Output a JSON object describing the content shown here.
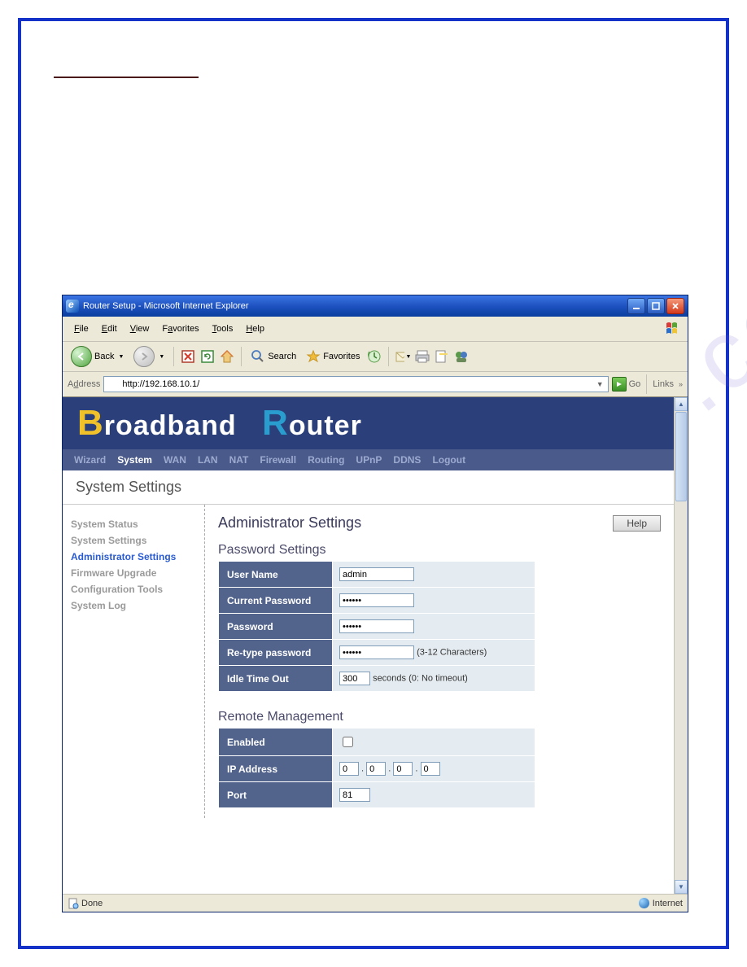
{
  "window": {
    "title": "Router Setup - Microsoft Internet Explorer"
  },
  "menubar": [
    "File",
    "Edit",
    "View",
    "Favorites",
    "Tools",
    "Help"
  ],
  "toolbar": {
    "back": "Back",
    "search": "Search",
    "favorites": "Favorites"
  },
  "addressbar": {
    "label": "Address",
    "url": "http://192.168.10.1/",
    "go": "Go",
    "links": "Links"
  },
  "router": {
    "brand_word1": "roadband",
    "brand_word2": "outer",
    "nav": [
      "Wizard",
      "System",
      "WAN",
      "LAN",
      "NAT",
      "Firewall",
      "Routing",
      "UPnP",
      "DDNS",
      "Logout"
    ],
    "active_nav": "System",
    "page_title": "System Settings",
    "sidebar": [
      "System Status",
      "System Settings",
      "Administrator Settings",
      "Firmware Upgrade",
      "Configuration Tools",
      "System Log"
    ],
    "active_sidebar": "Administrator Settings",
    "heading": "Administrator Settings",
    "help": "Help",
    "section1": {
      "title": "Password Settings",
      "username_label": "User Name",
      "username_value": "admin",
      "current_pw_label": "Current Password",
      "current_pw_value": "••••••",
      "pw_label": "Password",
      "pw_value": "••••••",
      "retype_label": "Re-type password",
      "retype_value": "••••••",
      "retype_hint": "(3-12 Characters)",
      "idle_label": "Idle Time Out",
      "idle_value": "300",
      "idle_hint": "seconds (0: No timeout)"
    },
    "section2": {
      "title": "Remote Management",
      "enabled_label": "Enabled",
      "enabled_value": false,
      "ip_label": "IP Address",
      "ip": [
        "0",
        "0",
        "0",
        "0"
      ],
      "port_label": "Port",
      "port_value": "81"
    }
  },
  "status": {
    "left": "Done",
    "right": "Internet"
  },
  "watermark": "manualshive.com"
}
